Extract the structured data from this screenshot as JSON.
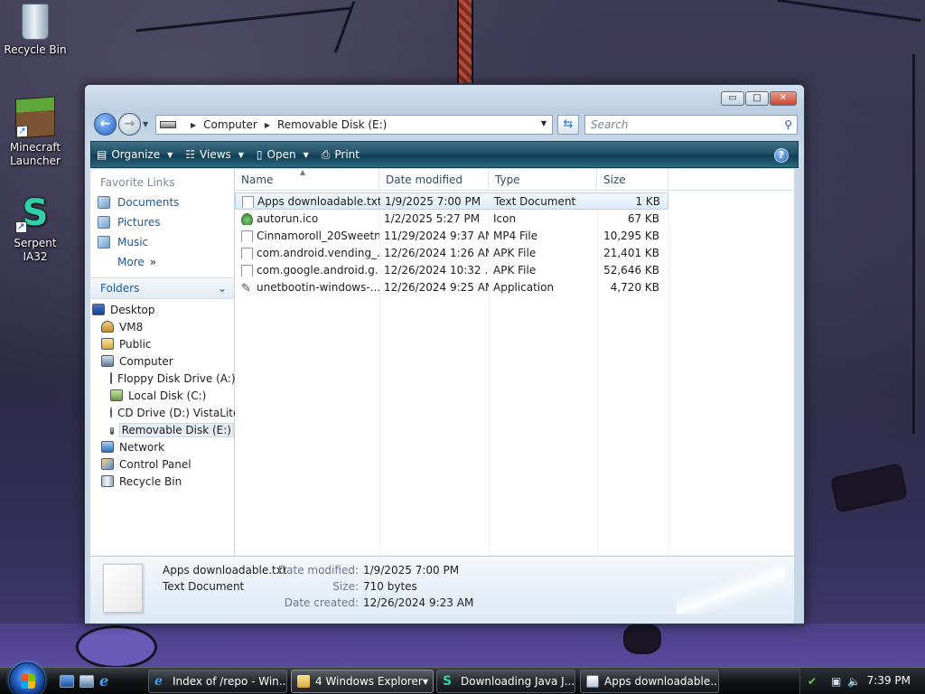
{
  "desktop": {
    "icons": [
      {
        "label": "Recycle Bin"
      },
      {
        "label": "Minecraft Launcher"
      },
      {
        "label": "Serpent IA32"
      }
    ]
  },
  "window": {
    "caption_buttons": {
      "minimize": "▭",
      "maximize": "□",
      "close": "✕"
    },
    "address": {
      "root": "Computer",
      "current": "Removable Disk (E:)"
    },
    "search_placeholder": "Search",
    "toolbar": {
      "organize": "Organize",
      "views": "Views",
      "open": "Open",
      "print": "Print",
      "help": "?"
    },
    "nav_pane": {
      "favorites_heading": "Favorite Links",
      "favorites": [
        "Documents",
        "Pictures",
        "Music"
      ],
      "more": "More",
      "folders_heading": "Folders",
      "tree": [
        "Desktop",
        "VM8",
        "Public",
        "Computer",
        "Floppy Disk Drive (A:)",
        "Local Disk (C:)",
        "CD Drive (D:) VistaLite",
        "Removable Disk (E:)",
        "Network",
        "Control Panel",
        "Recycle Bin"
      ],
      "selected": "Removable Disk (E:)"
    },
    "columns": [
      "Name",
      "Date modified",
      "Type",
      "Size"
    ],
    "files": [
      {
        "name": "Apps downloadable.txt",
        "date": "1/9/2025 7:00 PM",
        "type": "Text Document",
        "size": "1 KB"
      },
      {
        "name": "autorun.ico",
        "date": "1/2/2025 5:27 PM",
        "type": "Icon",
        "size": "67 KB"
      },
      {
        "name": "Cinnamoroll_20Sweetn...",
        "date": "11/29/2024 9:37 AM",
        "type": "MP4 File",
        "size": "10,295 KB"
      },
      {
        "name": "com.android.vending_...",
        "date": "12/26/2024 1:26 AM",
        "type": "APK File",
        "size": "21,401 KB"
      },
      {
        "name": "com.google.android.g...",
        "date": "12/26/2024 10:32 ...",
        "type": "APK File",
        "size": "52,646 KB"
      },
      {
        "name": "unetbootin-windows-...",
        "date": "12/26/2024 9:25 AM",
        "type": "Application",
        "size": "4,720 KB"
      }
    ],
    "details": {
      "name": "Apps downloadable.txt",
      "type": "Text Document",
      "modified_label": "Date modified:",
      "modified": "1/9/2025 7:00 PM",
      "size_label": "Size:",
      "size": "710 bytes",
      "created_label": "Date created:",
      "created": "12/26/2024 9:23 AM"
    }
  },
  "taskbar": {
    "buttons": [
      {
        "label": "Index of /repo - Win..."
      },
      {
        "label": "4 Windows Explorer"
      },
      {
        "label": "Downloading Java J..."
      },
      {
        "label": "Apps downloadable...."
      }
    ],
    "clock": "7:39 PM"
  }
}
